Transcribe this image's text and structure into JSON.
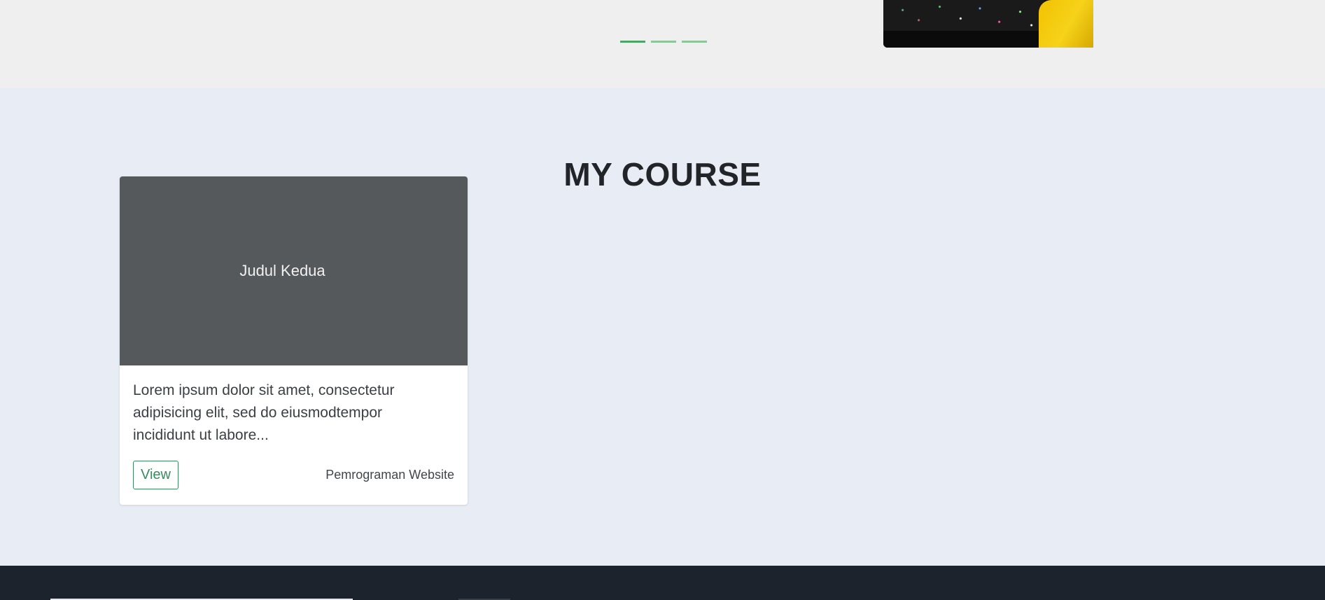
{
  "hero": {
    "carousel_indicators": [
      {
        "active": true
      },
      {
        "active": false
      },
      {
        "active": false
      }
    ]
  },
  "course_section": {
    "title": "MY COURSE",
    "cards": [
      {
        "image_title": "Judul Kedua",
        "description": "Lorem ipsum dolor sit amet, consectetur adipisicing elit, sed do eiusmodtempor incididunt ut labore...",
        "button_label": "View",
        "category": "Pemrograman Website"
      }
    ]
  },
  "colors": {
    "accent": "#3a8a5f",
    "section_background": "#e8edf5",
    "hero_background": "#efefef",
    "footer_background": "#1d232c",
    "card_image_background": "#55595c"
  }
}
